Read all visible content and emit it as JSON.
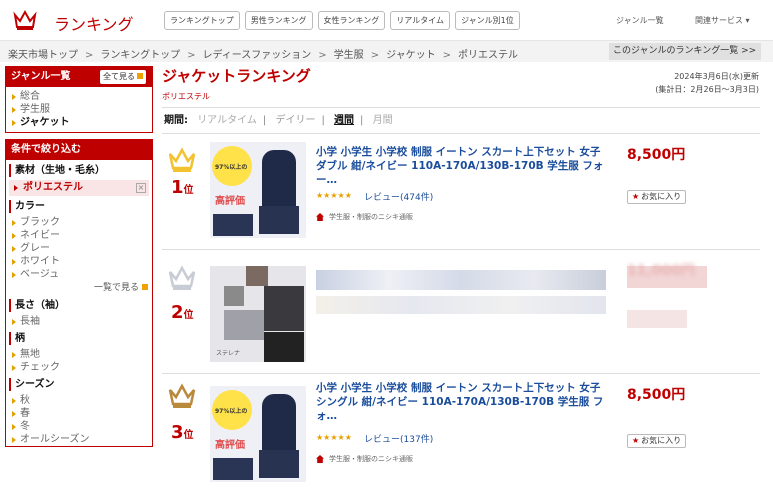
{
  "header": {
    "logo_text": "ランキング",
    "tabs": [
      "ランキングトップ",
      "男性ランキング",
      "女性ランキング",
      "リアルタイム",
      "ジャンル別1位"
    ],
    "genre_list": "ジャンル一覧",
    "related": "関連サービス"
  },
  "breadcrumb": [
    "楽天市場トップ",
    "ランキングトップ",
    "レディースファッション",
    "学生服",
    "ジャケット",
    "ポリエステル"
  ],
  "genre_other": "このジャンルのランキング一覧 >>",
  "sidebar": {
    "genre_title": "ジャンル一覧",
    "genre_all": "全て見る",
    "genre_items": [
      "総合",
      "学生服",
      "ジャケット"
    ],
    "filter_title": "条件で絞り込む",
    "material_title": "素材（生地・毛糸）",
    "material_selected": "ポリエステル",
    "color_title": "カラー",
    "colors": [
      "ブラック",
      "ネイビー",
      "グレー",
      "ホワイト",
      "ベージュ"
    ],
    "more": "一覧で見る",
    "sleeve_title": "長さ（袖）",
    "sleeves": [
      "長袖"
    ],
    "pattern_title": "柄",
    "patterns": [
      "無地",
      "チェック"
    ],
    "season_title": "シーズン",
    "seasons": [
      "秋",
      "春",
      "冬",
      "オールシーズン"
    ]
  },
  "main": {
    "title": "ジャケットランキング",
    "subtitle": "ポリエステル",
    "updated": "2024年3月6日(水)更新",
    "period_range": "(集計日：2月26日～3月3日)",
    "period_label": "期間:",
    "periods": [
      "リアルタイム",
      "デイリー",
      "週間",
      "月間"
    ],
    "current_period": "週間"
  },
  "items": [
    {
      "rank": "1",
      "rank_suffix": "位",
      "title": "小学 小学生 小学校 制服 イートン スカート上下セット 女子 ダブル 紺/ネイビー 110A-170A/130B-170B 学生服 フォー…",
      "stars": "★★★★★",
      "review": "レビュー(474件)",
      "shop": "学生服・制服のニシキ通販",
      "price": "8,500円",
      "fav": "お気に入り",
      "crown_color": "#f2c230",
      "thumb_badge": "97%以上の",
      "thumb_label": "高評価"
    },
    {
      "rank": "2",
      "rank_suffix": "位",
      "title": "",
      "stars": "",
      "review": "",
      "shop": "",
      "price": "11,000円",
      "fav": "",
      "crown_color": "#c8ccd4",
      "thumb_badge": "",
      "thumb_label": "ステレナ"
    },
    {
      "rank": "3",
      "rank_suffix": "位",
      "title": "小学 小学生 小学校 制服 イートン スカート上下セット 女子 シングル 紺/ネイビー 110A-170A/130B-170B 学生服 フォ…",
      "stars": "★★★★★",
      "review": "レビュー(137件)",
      "shop": "学生服・制服のニシキ通販",
      "price": "8,500円",
      "fav": "お気に入り",
      "crown_color": "#b98a3c",
      "thumb_badge": "97%以上の",
      "thumb_label": "高評価"
    }
  ]
}
